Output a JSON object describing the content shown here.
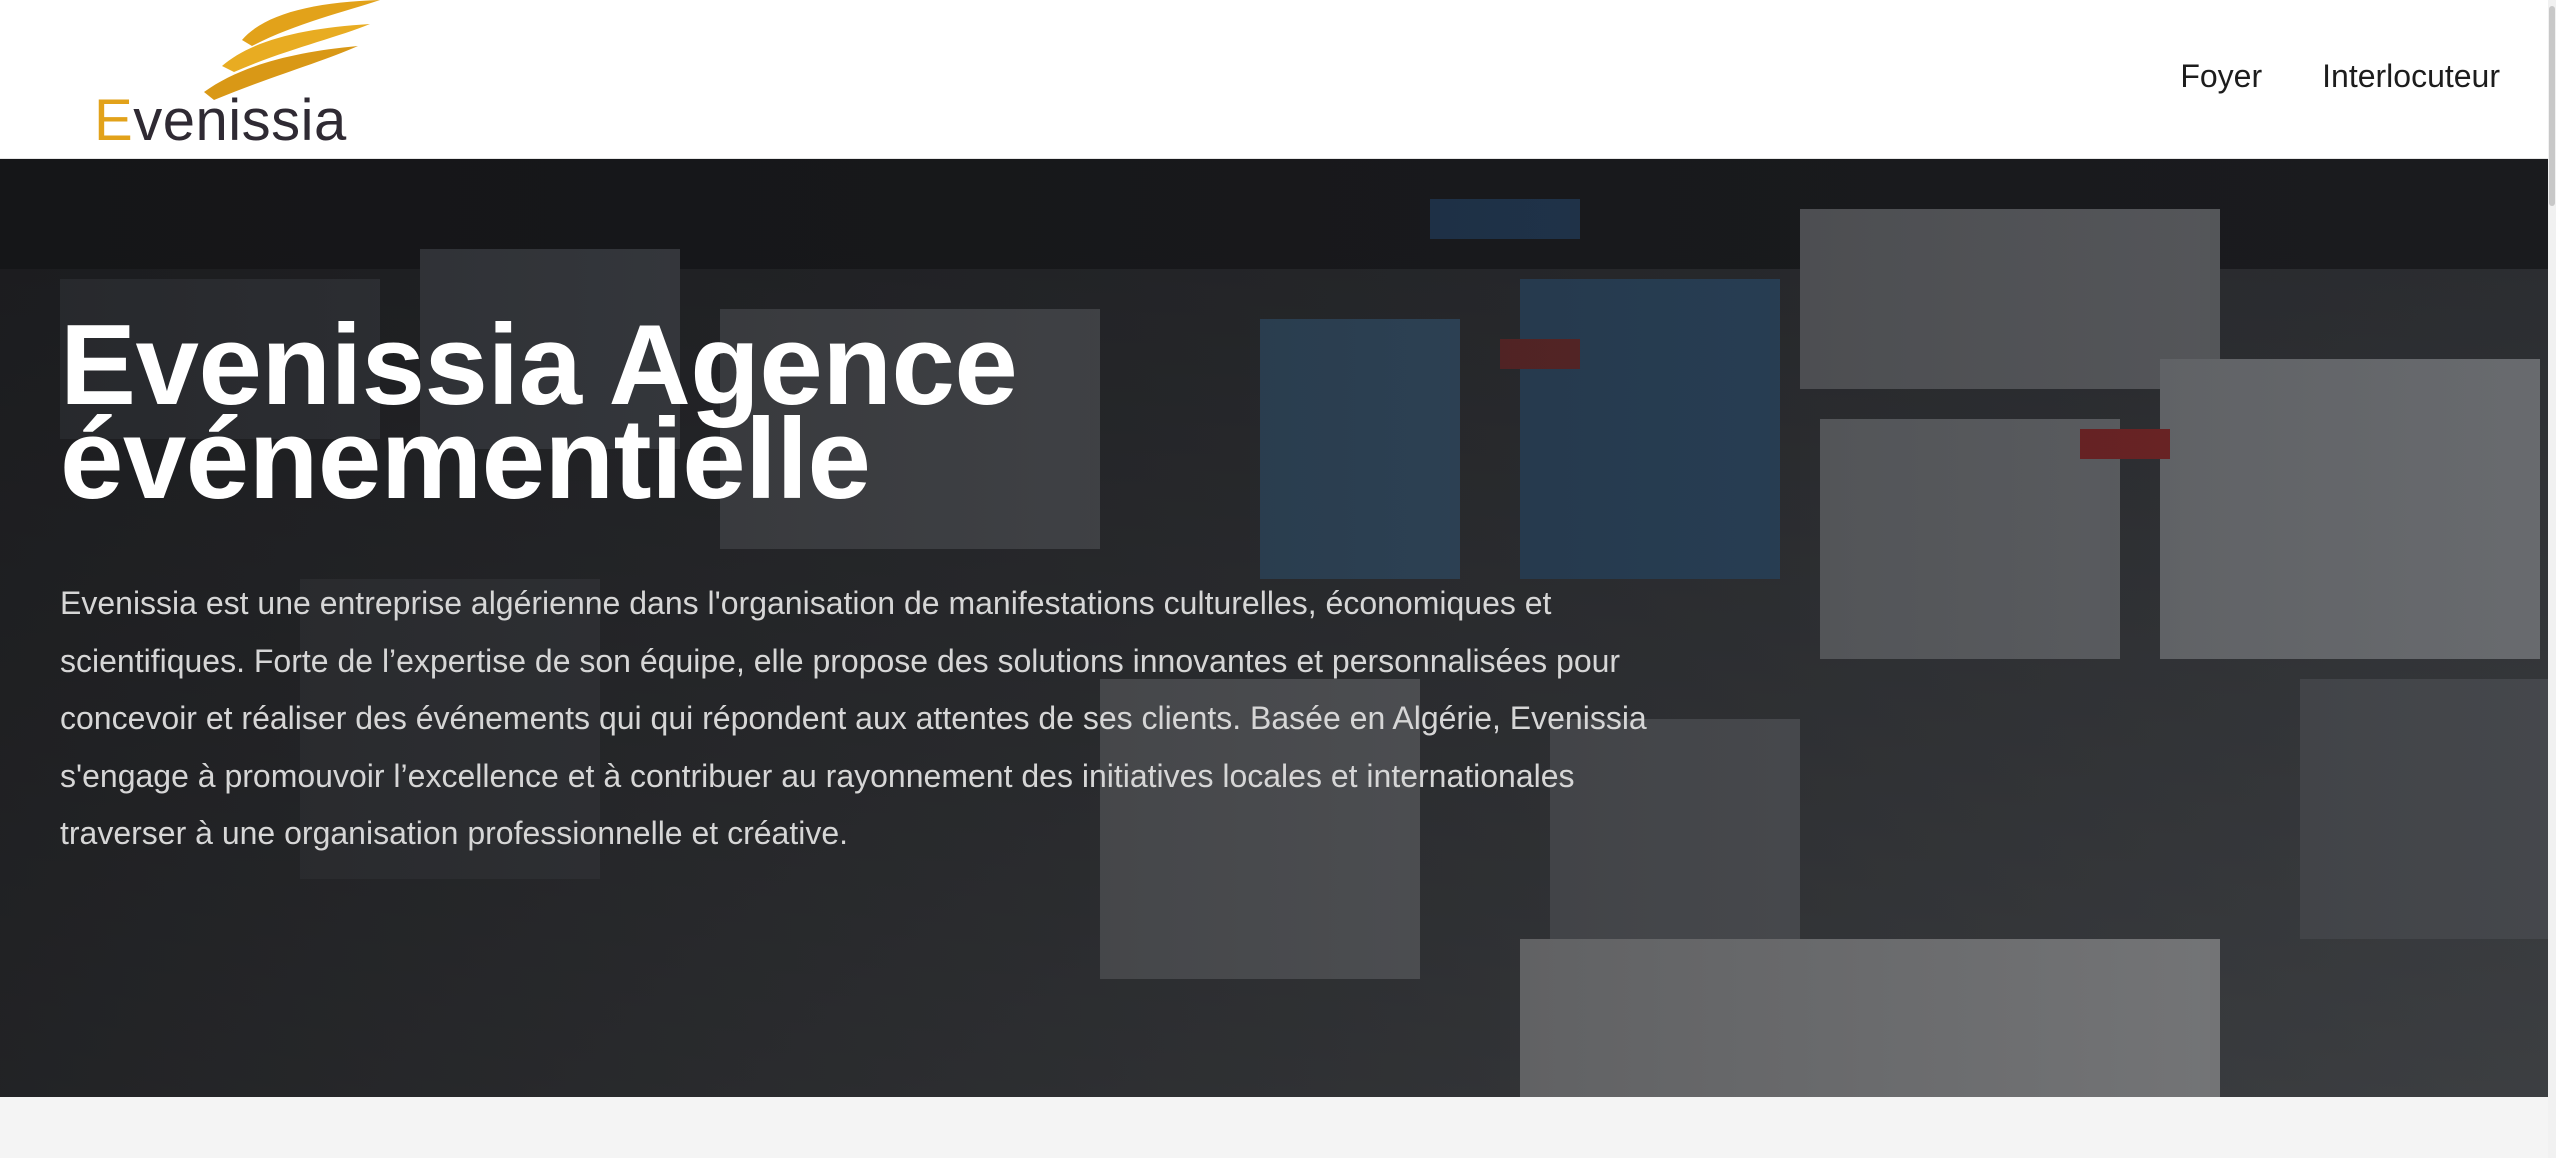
{
  "header": {
    "logo": {
      "initial": "E",
      "rest": "venissia",
      "accent_color": "#e2a21a",
      "icon": "swoosh-logo-icon"
    },
    "nav": [
      {
        "label": "Foyer"
      },
      {
        "label": "Interlocuteur"
      }
    ]
  },
  "hero": {
    "title_line1": "Evenissia Agence",
    "title_line2": "événementielle",
    "description": "Evenissia est une entreprise algérienne dans l'organisation de manifestations culturelles, économiques et scientifiques. Forte de l’expertise de son équipe, elle propose des solutions innovantes et personnalisées pour concevoir et réaliser des événements qui qui répondent aux attentes de ses clients. Basée en Algérie, Evenissia s'engage à promouvoir l’excellence et à contribuer au rayonnement des initiatives locales et internationales traverser à une organisation professionnelle et créative."
  }
}
